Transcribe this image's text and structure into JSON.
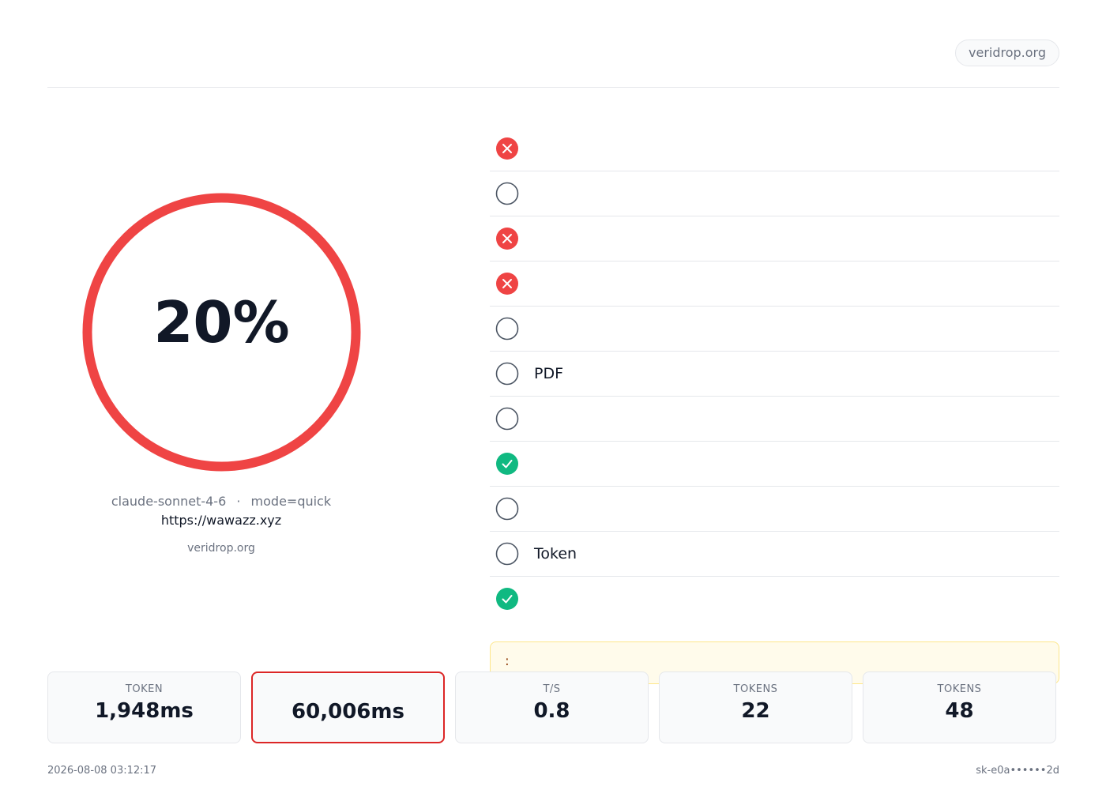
{
  "header": {
    "title": "",
    "domain": "veridrop.org"
  },
  "score": {
    "value": "20%",
    "label": "",
    "fraction": 0.2,
    "color": "#ef4444"
  },
  "meta": {
    "model": "claude-sonnet-4-6",
    "separator": "·",
    "mode": "mode=quick",
    "url": "https://wawazz.xyz",
    "provider": "veridrop.org"
  },
  "checks": [
    {
      "status": "fail",
      "name": "",
      "value": ""
    },
    {
      "status": "neutral",
      "name": "",
      "value": ""
    },
    {
      "status": "fail",
      "name": "",
      "value": ""
    },
    {
      "status": "fail",
      "name": "",
      "value": ""
    },
    {
      "status": "neutral",
      "name": "",
      "value": ""
    },
    {
      "status": "neutral",
      "name": "PDF",
      "value": ""
    },
    {
      "status": "neutral",
      "name": "",
      "value": ""
    },
    {
      "status": "pass",
      "name": "",
      "value": ""
    },
    {
      "status": "neutral",
      "name": "",
      "value": ""
    },
    {
      "status": "neutral",
      "name": "Token",
      "value": ""
    },
    {
      "status": "pass",
      "name": "",
      "value": ""
    }
  ],
  "notice": {
    "text": ":"
  },
  "stats": [
    {
      "label": "TOKEN",
      "value": "1,948ms",
      "alert": false
    },
    {
      "label": "",
      "value": "60,006ms",
      "alert": true
    },
    {
      "label": "T/S",
      "value": "0.8",
      "alert": false
    },
    {
      "label": "TOKENS",
      "value": "22",
      "alert": false
    },
    {
      "label": "TOKENS",
      "value": "48",
      "alert": false
    }
  ],
  "footer": {
    "timestamp": "2026-08-08 03:12:17",
    "key": "sk-e0a••••••2d"
  },
  "colors": {
    "fail": "#ef4444",
    "pass": "#10b981",
    "neutral": "#4b5563"
  }
}
